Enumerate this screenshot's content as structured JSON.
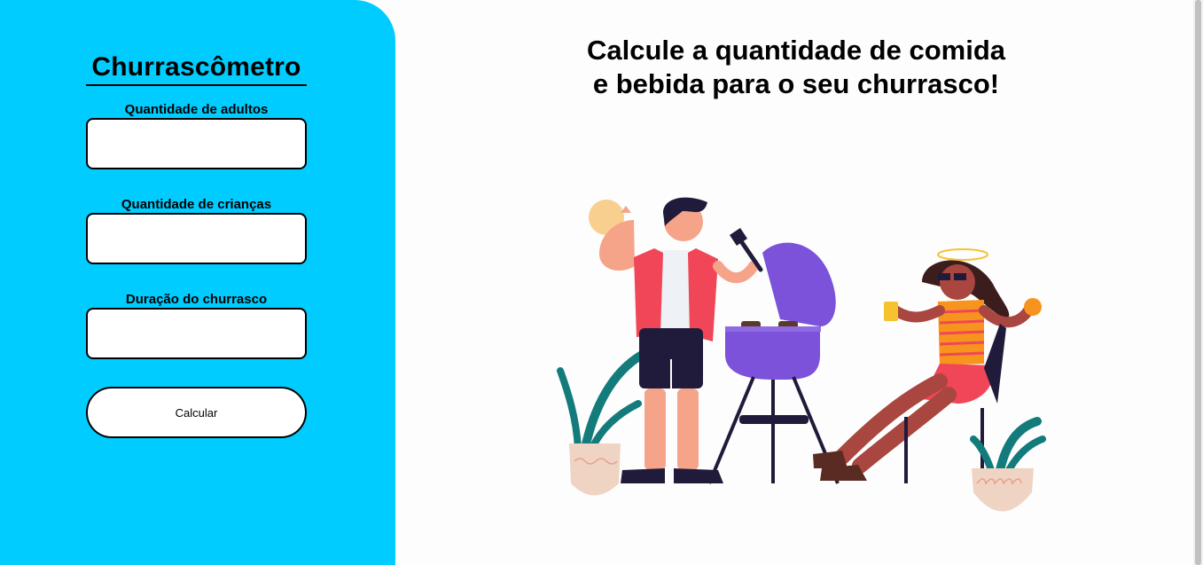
{
  "sidebar": {
    "title": "Churrascômetro",
    "fields": [
      {
        "label": "Quantidade de adultos",
        "value": ""
      },
      {
        "label": "Quantidade de crianças",
        "value": ""
      },
      {
        "label": "Duração do churrasco",
        "value": ""
      }
    ],
    "button_label": "Calcular"
  },
  "main": {
    "headline_line1": "Calcule a quantidade de comida",
    "headline_line2": "e bebida para o seu churrasco!"
  },
  "colors": {
    "sidebar_bg": "#00ccff",
    "page_bg": "#fdfdfd",
    "grill": "#7b52d9",
    "shirt": "#f04657",
    "plant": "#137b7b"
  }
}
